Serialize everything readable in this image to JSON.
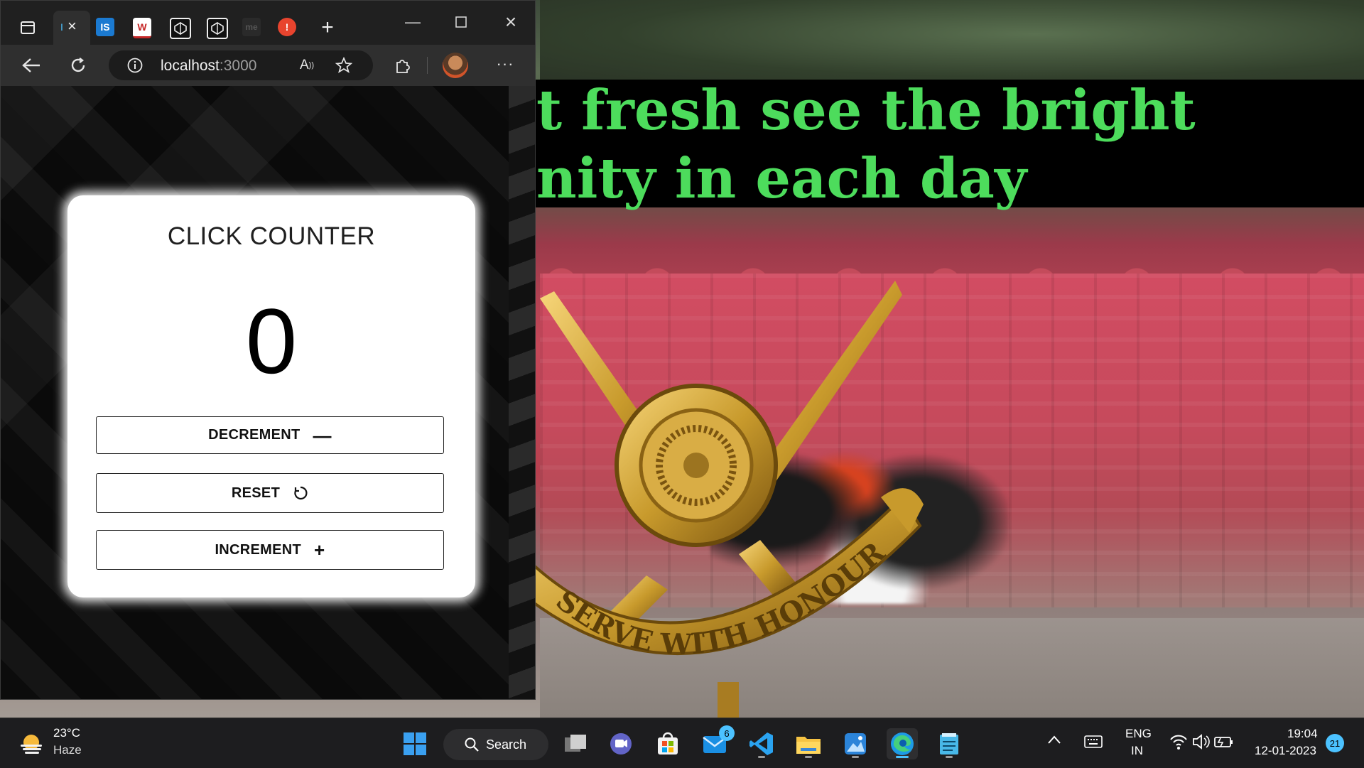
{
  "browser": {
    "tabs": [
      {
        "name": "active-tab",
        "label": "I"
      },
      {
        "name": "is-tab",
        "label": "IS"
      },
      {
        "name": "w-tab",
        "label": "W"
      },
      {
        "name": "codepen-tab-1",
        "label": ""
      },
      {
        "name": "codepen-tab-2",
        "label": ""
      },
      {
        "name": "me-tab",
        "label": "me"
      },
      {
        "name": "alert-tab",
        "label": "!"
      }
    ],
    "address": {
      "host": "localhost",
      "port": ":3000"
    }
  },
  "counter": {
    "title": "CLICK COUNTER",
    "value": "0",
    "decrement_label": "DECREMENT",
    "reset_label": "RESET",
    "increment_label": "INCREMENT"
  },
  "wallpaper": {
    "line1": "t fresh see the bright",
    "line2": "nity in each day",
    "emblem_motto": "SERVE WITH HONOUR",
    "banner_color": "#4ddc5c"
  },
  "taskbar": {
    "weather_temp": "23°C",
    "weather_desc": "Haze",
    "search_label": "Search",
    "mail_badge": "6",
    "lang_top": "ENG",
    "lang_bottom": "IN",
    "time": "19:04",
    "date": "12-01-2023",
    "notification_count": "21"
  }
}
